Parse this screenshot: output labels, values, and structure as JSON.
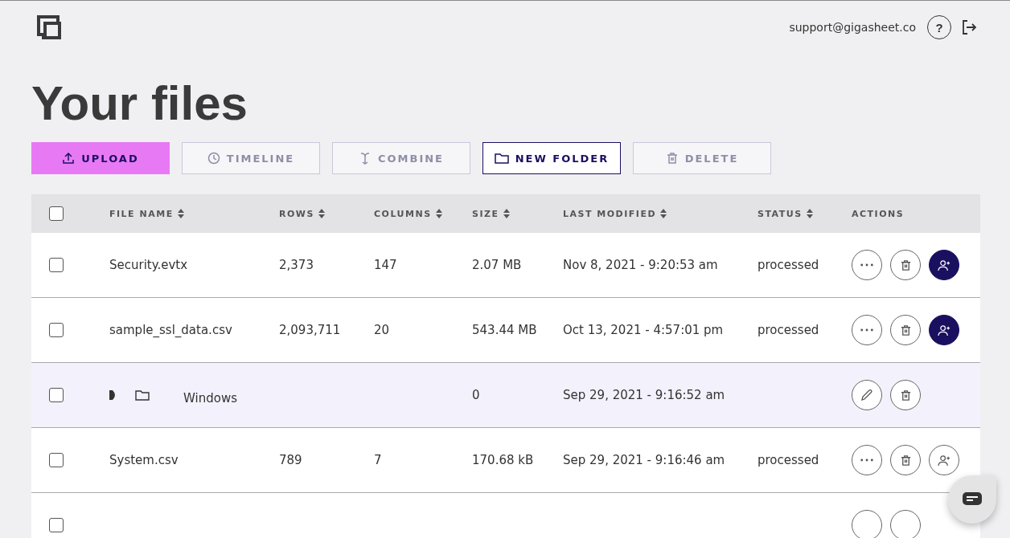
{
  "header": {
    "email": "support@gigasheet.co",
    "help_label": "?"
  },
  "title": "Your files",
  "toolbar": [
    {
      "label": "UPLOAD",
      "kind": "primary",
      "disabled": false
    },
    {
      "label": "TIMELINE",
      "kind": "outline",
      "disabled": true
    },
    {
      "label": "COMBINE",
      "kind": "outline",
      "disabled": true
    },
    {
      "label": "NEW FOLDER",
      "kind": "outline",
      "disabled": false
    },
    {
      "label": "DELETE",
      "kind": "outline",
      "disabled": true
    }
  ],
  "table": {
    "all_checked": false,
    "columns": [
      "FILE NAME",
      "ROWS",
      "COLUMNS",
      "SIZE",
      "LAST MODIFIED",
      "STATUS",
      "ACTIONS"
    ],
    "sortable": [
      true,
      true,
      true,
      true,
      true,
      true,
      false
    ],
    "rows": [
      {
        "kind": "file",
        "checked": false,
        "name": "Security.evtx",
        "rows": "2,373",
        "columns": "147",
        "size": "2.07 MB",
        "modified": "Nov 8, 2021 - 9:20:53 am",
        "status": "processed",
        "shared": true
      },
      {
        "kind": "file",
        "checked": false,
        "name": "sample_ssl_data.csv",
        "rows": "2,093,711",
        "columns": "20",
        "size": "543.44 MB",
        "modified": "Oct 13, 2021 - 4:57:01 pm",
        "status": "processed",
        "shared": true
      },
      {
        "kind": "folder",
        "checked": false,
        "name": "Windows",
        "size": "0",
        "modified": "Sep 29, 2021 - 9:16:52 am",
        "expanded": false
      },
      {
        "kind": "file",
        "checked": false,
        "name": "System.csv",
        "rows": "789",
        "columns": "7",
        "size": "170.68 kB",
        "modified": "Sep 29, 2021 - 9:16:46 am",
        "status": "processed",
        "shared": false
      },
      {
        "kind": "partial",
        "checked": false
      }
    ]
  }
}
